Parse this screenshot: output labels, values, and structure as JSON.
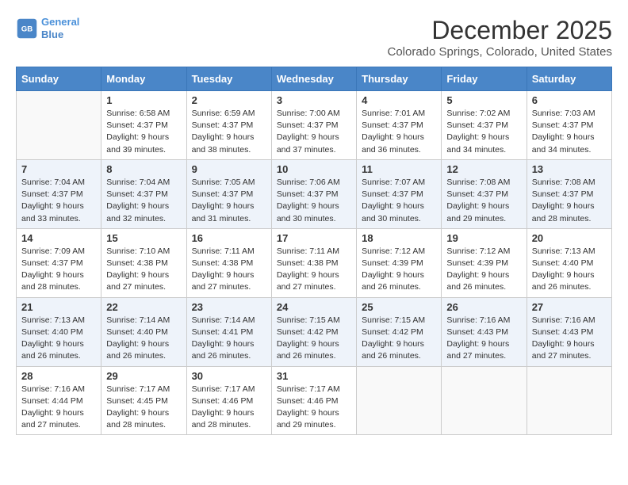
{
  "logo": {
    "line1": "General",
    "line2": "Blue"
  },
  "title": "December 2025",
  "location": "Colorado Springs, Colorado, United States",
  "days_of_week": [
    "Sunday",
    "Monday",
    "Tuesday",
    "Wednesday",
    "Thursday",
    "Friday",
    "Saturday"
  ],
  "weeks": [
    [
      {
        "day": "",
        "info": ""
      },
      {
        "day": "1",
        "info": "Sunrise: 6:58 AM\nSunset: 4:37 PM\nDaylight: 9 hours\nand 39 minutes."
      },
      {
        "day": "2",
        "info": "Sunrise: 6:59 AM\nSunset: 4:37 PM\nDaylight: 9 hours\nand 38 minutes."
      },
      {
        "day": "3",
        "info": "Sunrise: 7:00 AM\nSunset: 4:37 PM\nDaylight: 9 hours\nand 37 minutes."
      },
      {
        "day": "4",
        "info": "Sunrise: 7:01 AM\nSunset: 4:37 PM\nDaylight: 9 hours\nand 36 minutes."
      },
      {
        "day": "5",
        "info": "Sunrise: 7:02 AM\nSunset: 4:37 PM\nDaylight: 9 hours\nand 34 minutes."
      },
      {
        "day": "6",
        "info": "Sunrise: 7:03 AM\nSunset: 4:37 PM\nDaylight: 9 hours\nand 34 minutes."
      }
    ],
    [
      {
        "day": "7",
        "info": "Sunrise: 7:04 AM\nSunset: 4:37 PM\nDaylight: 9 hours\nand 33 minutes."
      },
      {
        "day": "8",
        "info": "Sunrise: 7:04 AM\nSunset: 4:37 PM\nDaylight: 9 hours\nand 32 minutes."
      },
      {
        "day": "9",
        "info": "Sunrise: 7:05 AM\nSunset: 4:37 PM\nDaylight: 9 hours\nand 31 minutes."
      },
      {
        "day": "10",
        "info": "Sunrise: 7:06 AM\nSunset: 4:37 PM\nDaylight: 9 hours\nand 30 minutes."
      },
      {
        "day": "11",
        "info": "Sunrise: 7:07 AM\nSunset: 4:37 PM\nDaylight: 9 hours\nand 30 minutes."
      },
      {
        "day": "12",
        "info": "Sunrise: 7:08 AM\nSunset: 4:37 PM\nDaylight: 9 hours\nand 29 minutes."
      },
      {
        "day": "13",
        "info": "Sunrise: 7:08 AM\nSunset: 4:37 PM\nDaylight: 9 hours\nand 28 minutes."
      }
    ],
    [
      {
        "day": "14",
        "info": "Sunrise: 7:09 AM\nSunset: 4:37 PM\nDaylight: 9 hours\nand 28 minutes."
      },
      {
        "day": "15",
        "info": "Sunrise: 7:10 AM\nSunset: 4:38 PM\nDaylight: 9 hours\nand 27 minutes."
      },
      {
        "day": "16",
        "info": "Sunrise: 7:11 AM\nSunset: 4:38 PM\nDaylight: 9 hours\nand 27 minutes."
      },
      {
        "day": "17",
        "info": "Sunrise: 7:11 AM\nSunset: 4:38 PM\nDaylight: 9 hours\nand 27 minutes."
      },
      {
        "day": "18",
        "info": "Sunrise: 7:12 AM\nSunset: 4:39 PM\nDaylight: 9 hours\nand 26 minutes."
      },
      {
        "day": "19",
        "info": "Sunrise: 7:12 AM\nSunset: 4:39 PM\nDaylight: 9 hours\nand 26 minutes."
      },
      {
        "day": "20",
        "info": "Sunrise: 7:13 AM\nSunset: 4:40 PM\nDaylight: 9 hours\nand 26 minutes."
      }
    ],
    [
      {
        "day": "21",
        "info": "Sunrise: 7:13 AM\nSunset: 4:40 PM\nDaylight: 9 hours\nand 26 minutes."
      },
      {
        "day": "22",
        "info": "Sunrise: 7:14 AM\nSunset: 4:40 PM\nDaylight: 9 hours\nand 26 minutes."
      },
      {
        "day": "23",
        "info": "Sunrise: 7:14 AM\nSunset: 4:41 PM\nDaylight: 9 hours\nand 26 minutes."
      },
      {
        "day": "24",
        "info": "Sunrise: 7:15 AM\nSunset: 4:42 PM\nDaylight: 9 hours\nand 26 minutes."
      },
      {
        "day": "25",
        "info": "Sunrise: 7:15 AM\nSunset: 4:42 PM\nDaylight: 9 hours\nand 26 minutes."
      },
      {
        "day": "26",
        "info": "Sunrise: 7:16 AM\nSunset: 4:43 PM\nDaylight: 9 hours\nand 27 minutes."
      },
      {
        "day": "27",
        "info": "Sunrise: 7:16 AM\nSunset: 4:43 PM\nDaylight: 9 hours\nand 27 minutes."
      }
    ],
    [
      {
        "day": "28",
        "info": "Sunrise: 7:16 AM\nSunset: 4:44 PM\nDaylight: 9 hours\nand 27 minutes."
      },
      {
        "day": "29",
        "info": "Sunrise: 7:17 AM\nSunset: 4:45 PM\nDaylight: 9 hours\nand 28 minutes."
      },
      {
        "day": "30",
        "info": "Sunrise: 7:17 AM\nSunset: 4:46 PM\nDaylight: 9 hours\nand 28 minutes."
      },
      {
        "day": "31",
        "info": "Sunrise: 7:17 AM\nSunset: 4:46 PM\nDaylight: 9 hours\nand 29 minutes."
      },
      {
        "day": "",
        "info": ""
      },
      {
        "day": "",
        "info": ""
      },
      {
        "day": "",
        "info": ""
      }
    ]
  ]
}
